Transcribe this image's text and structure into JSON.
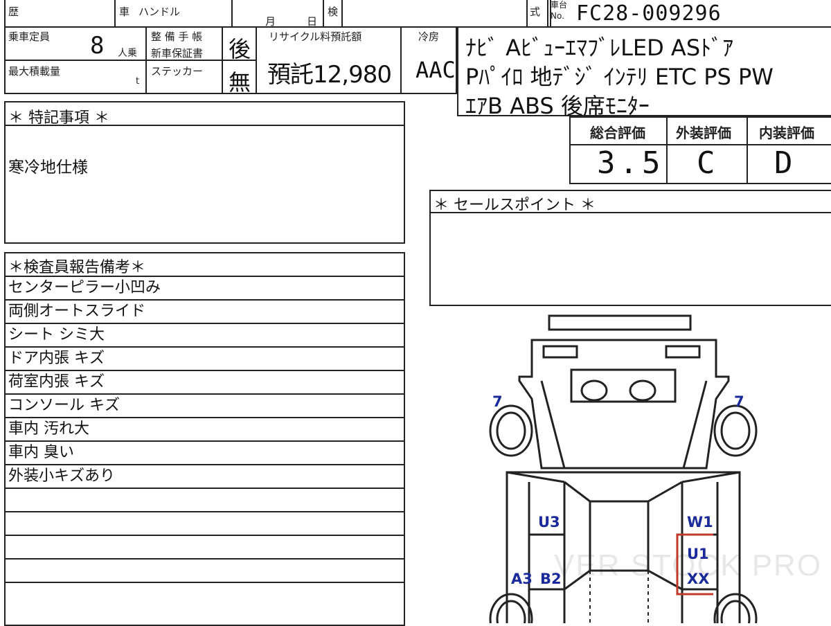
{
  "header": {
    "history_label": "歴",
    "car_label": "車",
    "handle_label": "ハンドル",
    "month_label": "月",
    "day_label": "日",
    "inspection_label": "検",
    "type_label": "式",
    "chassis_label_top": "車台",
    "chassis_label_bottom": "No.",
    "chassis_no": "FC28-009296"
  },
  "specs": {
    "capacity_label": "乗車定員",
    "capacity_value": "8",
    "capacity_unit": "人乗",
    "maintenance_label": "整 備 手 帳",
    "warranty_label": "新車保証書",
    "maintenance_value": "後",
    "recycle_label": "リサイクル料預託額",
    "recycle_value": "預託12,980",
    "ac_label": "冷房",
    "ac_value": "AAC",
    "max_load_label": "最大積載量",
    "max_load_unit": "t",
    "sticker_label": "ステッカー",
    "sticker_value": "無"
  },
  "options": {
    "line1": "ﾅﾋﾞ AﾋﾞｭｰｴﾏﾌﾞﾚLED ASﾄﾞｱ",
    "line2": "Pﾊﾟｲﾛ 地ﾃﾞｼﾞ ｲﾝﾃﾘ ETC PS PW",
    "line3": "ｴｱB ABS 後席ﾓﾆﾀｰ"
  },
  "ratings": {
    "overall_label": "総合評価",
    "overall_value": "3.5",
    "exterior_label": "外装評価",
    "exterior_value": "C",
    "interior_label": "内装評価",
    "interior_value": "D"
  },
  "special_notes": {
    "title": "＊ 特記事項 ＊",
    "text": "寒冷地仕様"
  },
  "sales_point": {
    "title": "＊ セールスポイント ＊"
  },
  "inspector_report": {
    "title": "＊検査員報告備考＊",
    "rows": [
      "センターピラー小凹み",
      "両側オートスライド",
      "シート シミ大",
      "ドア内張 キズ",
      "荷室内張 キズ",
      "コンソール キズ",
      "車内 汚れ大",
      "車内 臭い",
      "外装小キズあり",
      "",
      "",
      "",
      "",
      ""
    ]
  },
  "diagram": {
    "marks": {
      "front_left": "7",
      "front_right": "7",
      "u3": "U3",
      "w1": "W1",
      "u1": "U1",
      "xx": "XX",
      "a3": "A3",
      "b2": "B2"
    },
    "mark_color": "#1a2a9a",
    "highlight_color": "#c0392b"
  },
  "watermark": "VER STOCK PRO"
}
